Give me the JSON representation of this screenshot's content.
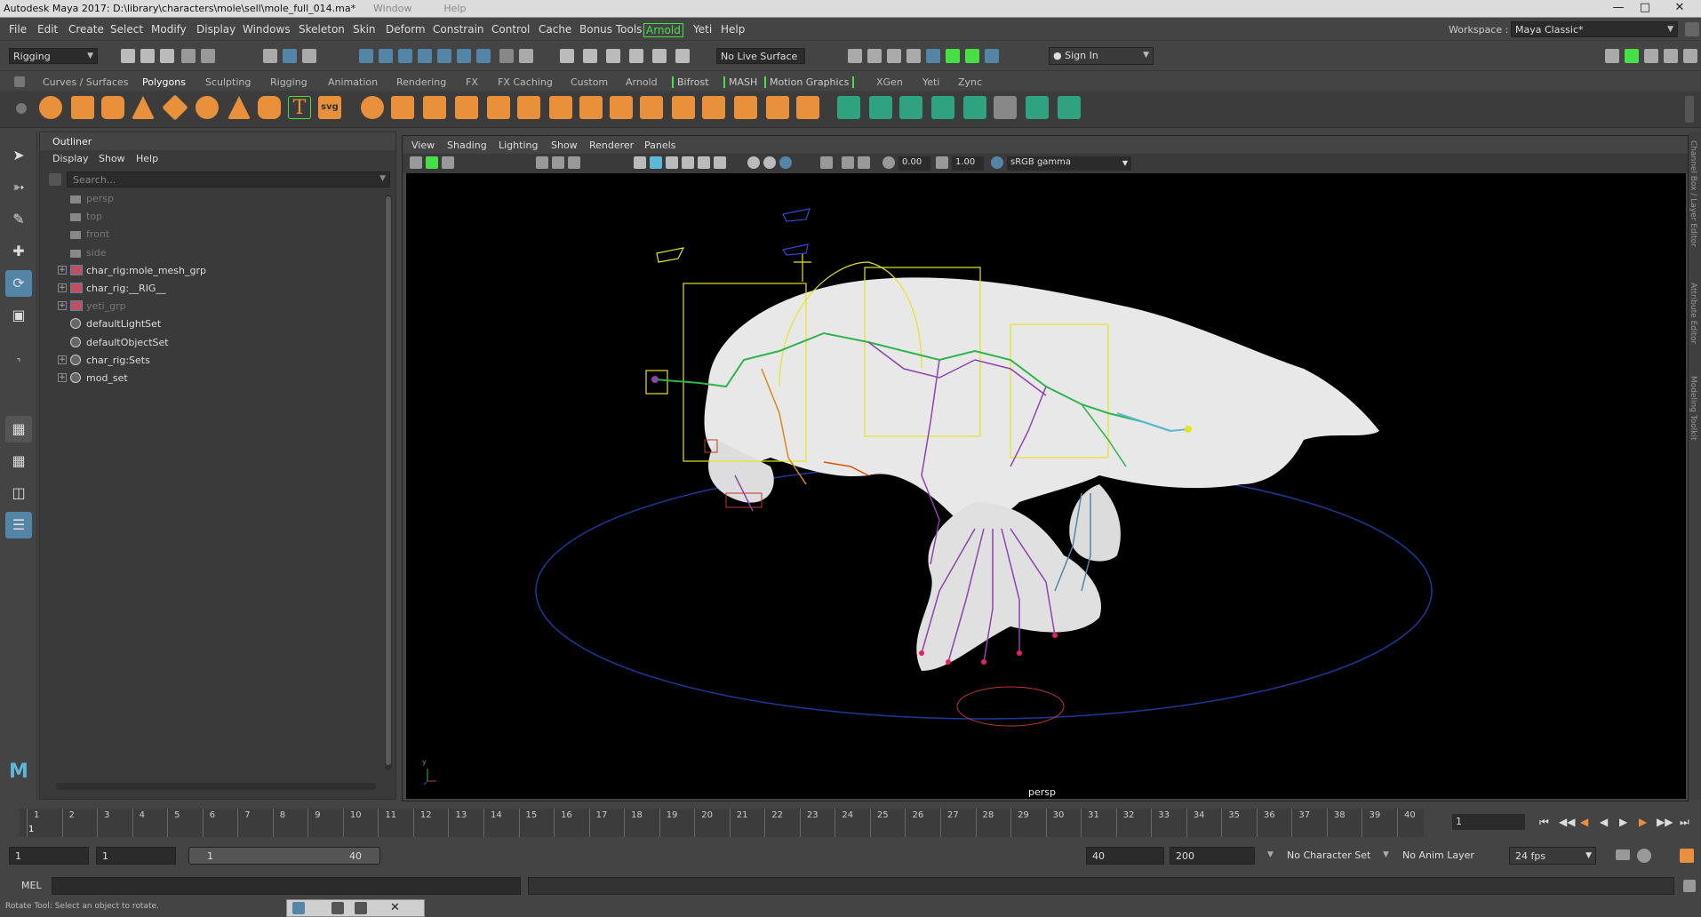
{
  "window": {
    "title": "Autodesk Maya 2017: D:\\library\\characters\\mole\\sell\\mole_full_014.ma*",
    "ghost_menu": [
      "Window",
      "Help"
    ],
    "controls": [
      "minimize",
      "maximize",
      "close"
    ]
  },
  "menubar": {
    "items": [
      "File",
      "Edit",
      "Create",
      "Select",
      "Modify",
      "Display",
      "Windows",
      "Skeleton",
      "Skin",
      "Deform",
      "Constrain",
      "Control",
      "Cache",
      "Bonus Tools",
      "Arnold",
      "Yeti",
      "Help"
    ],
    "workspace_label": "Workspace :",
    "workspace_value": "Maya Classic*"
  },
  "statusline": {
    "menuset": "Rigging",
    "live_surface": "No Live Surface",
    "sign_in": "Sign In"
  },
  "shelf_tabs": {
    "items": [
      "Curves / Surfaces",
      "Polygons",
      "Sculpting",
      "Rigging",
      "Animation",
      "Rendering",
      "FX",
      "FX Caching",
      "Custom",
      "Arnold",
      "Bifrost",
      "MASH",
      "Motion Graphics",
      "XGen",
      "Yeti",
      "Zync"
    ],
    "active": "Polygons"
  },
  "shelf": {
    "text_icon": "T",
    "svg_icon": "svg"
  },
  "outliner": {
    "title": "Outliner",
    "menus": [
      "Display",
      "Show",
      "Help"
    ],
    "search_placeholder": "Search...",
    "items": [
      {
        "label": "persp",
        "type": "camera",
        "dim": true,
        "expandable": false
      },
      {
        "label": "top",
        "type": "camera",
        "dim": true,
        "expandable": false
      },
      {
        "label": "front",
        "type": "camera",
        "dim": true,
        "expandable": false
      },
      {
        "label": "side",
        "type": "camera",
        "dim": true,
        "expandable": false
      },
      {
        "label": "char_rig:mole_mesh_grp",
        "type": "group",
        "dim": false,
        "expandable": true
      },
      {
        "label": "char_rig:__RIG__",
        "type": "group",
        "dim": false,
        "expandable": true
      },
      {
        "label": "yeti_grp",
        "type": "group",
        "dim": true,
        "expandable": true
      },
      {
        "label": "defaultLightSet",
        "type": "set",
        "dim": false,
        "expandable": false
      },
      {
        "label": "defaultObjectSet",
        "type": "set",
        "dim": false,
        "expandable": false
      },
      {
        "label": "char_rig:Sets",
        "type": "set",
        "dim": false,
        "expandable": true
      },
      {
        "label": "mod_set",
        "type": "set",
        "dim": false,
        "expandable": true
      }
    ]
  },
  "viewport": {
    "menus": [
      "View",
      "Shading",
      "Lighting",
      "Show",
      "Renderer",
      "Panels"
    ],
    "exposure": "0.00",
    "gamma": "1.00",
    "color_space": "sRGB gamma",
    "camera_label": "persp",
    "axis_y": "y"
  },
  "right_panels": [
    "Channel Box / Layer Editor",
    "Attribute Editor",
    "Modeling Toolkit"
  ],
  "timeslider": {
    "start": 1,
    "end": 40,
    "current_marker": "1",
    "tick_labels": [
      "1",
      "2",
      "3",
      "4",
      "5",
      "6",
      "7",
      "8",
      "9",
      "10",
      "11",
      "12",
      "13",
      "14",
      "15",
      "16",
      "17",
      "18",
      "19",
      "20",
      "21",
      "22",
      "23",
      "24",
      "25",
      "26",
      "27",
      "28",
      "29",
      "30",
      "31",
      "32",
      "33",
      "34",
      "35",
      "36",
      "37",
      "38",
      "39",
      "40"
    ],
    "current_frame": "1"
  },
  "range": {
    "anim_start": "1",
    "play_start": "1",
    "slider_start": "1",
    "slider_end": "40",
    "play_end": "40",
    "anim_end": "200",
    "character_set": "No Character Set",
    "anim_layer": "No Anim Layer",
    "fps": "24 fps"
  },
  "commandline": {
    "label": "MEL"
  },
  "helpline": {
    "text": "Rotate Tool: Select an object to rotate."
  },
  "colors": {
    "accent_blue": "#5285a6",
    "arnold_green": "#46e046",
    "shelf_orange": "#e8903a",
    "mesh_white": "#e8e8e8",
    "ground_circle": "#1a3a9a",
    "control_yellow": "#e5e51e"
  }
}
